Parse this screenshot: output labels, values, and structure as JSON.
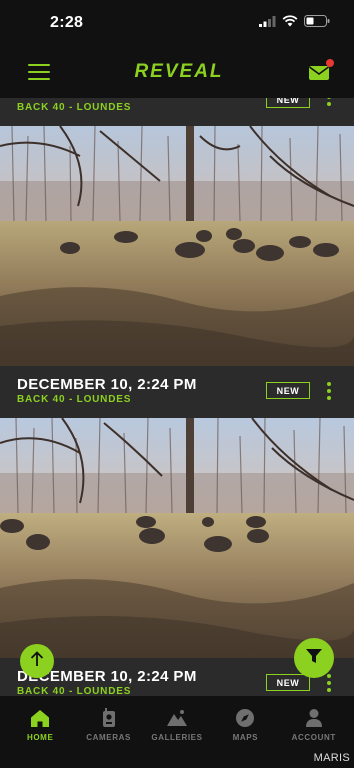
{
  "status_bar": {
    "time": "2:28"
  },
  "header": {
    "brand": "REVEAL"
  },
  "cards": [
    {
      "date": "",
      "camera": "BACK 40 - LOUNDES",
      "badge": "NEW"
    },
    {
      "date": "DECEMBER 10, 2:24 PM",
      "camera": "BACK 40 - LOUNDES",
      "badge": "NEW"
    },
    {
      "date": "DECEMBER 10, 2:24 PM",
      "camera": "BACK 40 - LOUNDES",
      "badge": "NEW"
    }
  ],
  "bottom_nav": [
    {
      "label": "HOME",
      "icon": "home-icon",
      "active": true
    },
    {
      "label": "CAMERAS",
      "icon": "camera-icon",
      "active": false
    },
    {
      "label": "GALLERIES",
      "icon": "gallery-icon",
      "active": false
    },
    {
      "label": "MAPS",
      "icon": "compass-icon",
      "active": false
    },
    {
      "label": "ACCOUNT",
      "icon": "user-icon",
      "active": false
    }
  ],
  "watermark": "MARIS",
  "colors": {
    "accent": "#8cd11f",
    "background": "#111111",
    "card": "#2b2b2b",
    "notification": "#e53935"
  }
}
